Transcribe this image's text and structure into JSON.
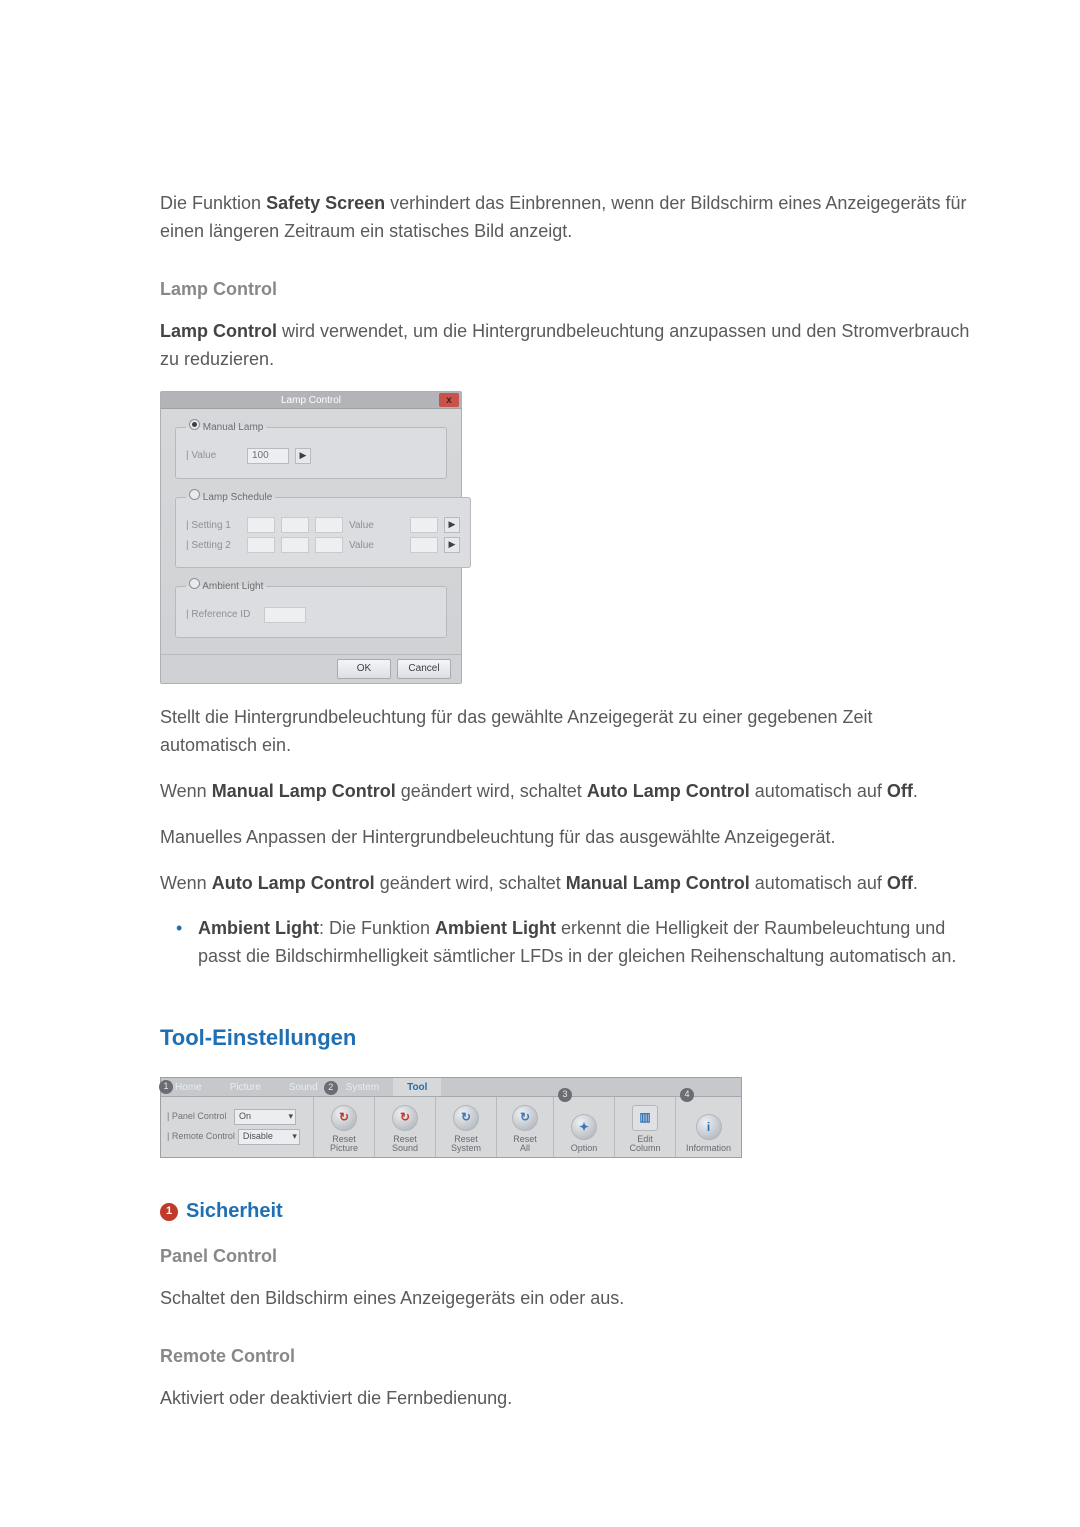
{
  "intro": {
    "p1_pre": "Die Funktion ",
    "p1_bold": "Safety Screen",
    "p1_post": " verhindert das Einbrennen, wenn der Bildschirm eines Anzeigegeräts für einen längeren Zeitraum ein statisches Bild anzeigt."
  },
  "lamp": {
    "heading": "Lamp Control",
    "p1_bold": "Lamp Control",
    "p1_rest": " wird verwendet, um die Hintergrundbeleuchtung anzupassen und den Stromverbrauch zu reduzieren.",
    "dlg": {
      "title": "Lamp Control",
      "close": "x",
      "grp1_legend": "Manual Lamp",
      "grp1_label": "| Value",
      "grp1_value": "100",
      "grp1_btn": "▶",
      "grp2_legend": "Lamp Schedule",
      "grp2_row1": "| Setting 1",
      "grp2_row2": "| Setting 2",
      "grp2_val": "Value",
      "grp3_legend": "Ambient Light",
      "grp3_label": "| Reference ID",
      "ok": "OK",
      "cancel": "Cancel"
    },
    "after1": "Stellt die Hintergrundbeleuchtung für das gewählte Anzeigegerät zu einer gegebenen Zeit automatisch ein.",
    "after2_pre": "Wenn ",
    "after2_b1": "Manual Lamp Control",
    "after2_mid": " geändert wird, schaltet ",
    "after2_b2": "Auto Lamp Control",
    "after2_post": " automatisch auf ",
    "after2_off": "Off",
    "after2_dot": ".",
    "after3": "Manuelles Anpassen der Hintergrundbeleuchtung für das ausgewählte Anzeigegerät.",
    "after4_pre": "Wenn ",
    "after4_b1": "Auto Lamp Control",
    "after4_mid": " geändert wird, schaltet ",
    "after4_b2": "Manual Lamp Control",
    "after4_post": " automatisch auf ",
    "after4_off": "Off",
    "after4_dot": ".",
    "ambient_b1": "Ambient Light",
    "ambient_mid": ": Die Funktion ",
    "ambient_b2": "Ambient Light",
    "ambient_rest": " erkennt die Helligkeit der Raumbeleuchtung und passt die Bildschirmhelligkeit sämtlicher LFDs in der gleichen Reihenschaltung automatisch an."
  },
  "tool": {
    "heading": "Tool-Einstellungen",
    "ribbon": {
      "tabs": [
        "Home",
        "Picture",
        "Sound",
        "System",
        "Tool"
      ],
      "badges": {
        "b1": "1",
        "b2": "2",
        "b3": "3",
        "b4": "4"
      },
      "security": {
        "panel_label": "| Panel Control",
        "panel_value": "On",
        "remote_label": "| Remote Control",
        "remote_value": "Disable"
      },
      "cells": {
        "reset_picture": "Reset\nPicture",
        "reset_sound": "Reset\nSound",
        "reset_system": "Reset\nSystem",
        "reset_all": "Reset\nAll",
        "option": "Option",
        "edit_column": "Edit\nColumn",
        "information": "Information"
      }
    },
    "sicherheit": {
      "num": "1",
      "title": "Sicherheit"
    },
    "panel": {
      "heading": "Panel Control",
      "body": "Schaltet den Bildschirm eines Anzeigegeräts ein oder aus."
    },
    "remote": {
      "heading": "Remote Control",
      "body": "Aktiviert oder deaktiviert die Fernbedienung."
    }
  }
}
